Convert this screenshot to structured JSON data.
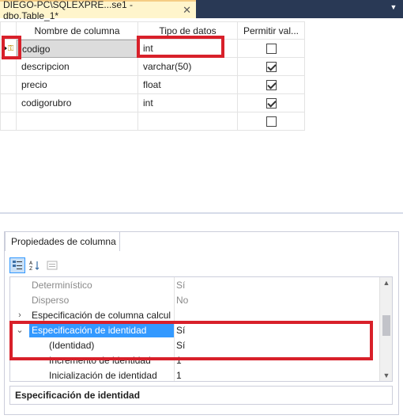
{
  "tab": {
    "title": "DIEGO-PC\\SQLEXPRE...se1 - dbo.Table_1*",
    "close_glyph": "✕",
    "menu_glyph": "▼"
  },
  "grid": {
    "headers": [
      "Nombre de columna",
      "Tipo de datos",
      "Permitir val..."
    ],
    "rows": [
      {
        "name": "codigo",
        "type": "int",
        "allow_nulls": false,
        "primary_key": true,
        "selected": true
      },
      {
        "name": "descripcion",
        "type": "varchar(50)",
        "allow_nulls": true
      },
      {
        "name": "precio",
        "type": "float",
        "allow_nulls": true
      },
      {
        "name": "codigorubro",
        "type": "int",
        "allow_nulls": true
      },
      {
        "name": "",
        "type": "",
        "allow_nulls": false
      }
    ]
  },
  "properties": {
    "tab_label": "Propiedades de columna",
    "rows": [
      {
        "expander": "",
        "name": "Determinístico",
        "value": "Sí",
        "style": "dim"
      },
      {
        "expander": "",
        "name": "Disperso",
        "value": "No",
        "style": "dim"
      },
      {
        "expander": "›",
        "name": "Especificación de columna calcul",
        "value": "",
        "style": "normal"
      },
      {
        "expander": "⌄",
        "name": "Especificación de identidad",
        "value": "Sí",
        "style": "selected"
      },
      {
        "expander": "",
        "name": "(Identidad)",
        "value": "Sí",
        "style": "indent"
      },
      {
        "expander": "",
        "name": "Incremento de identidad",
        "value": "1",
        "style": "indent"
      },
      {
        "expander": "",
        "name": "Inicialización de identidad",
        "value": "1",
        "style": "indent"
      }
    ],
    "description": "Especificación de identidad"
  },
  "colors": {
    "annotation_red": "#d8202a",
    "selection_blue": "#3399ff",
    "tab_bar": "#293955",
    "active_tab": "#fff5cc"
  }
}
